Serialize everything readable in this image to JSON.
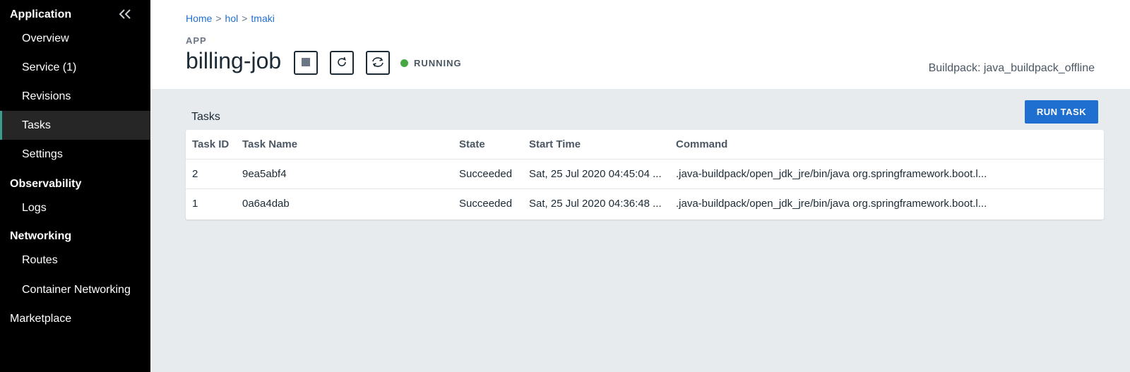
{
  "sidebar": {
    "sections": {
      "application": "Application",
      "observability": "Observability",
      "networking": "Networking",
      "marketplace": "Marketplace"
    },
    "items": [
      {
        "label": "Overview"
      },
      {
        "label": "Service (1)"
      },
      {
        "label": "Revisions"
      },
      {
        "label": "Tasks"
      },
      {
        "label": "Settings"
      },
      {
        "label": "Logs"
      },
      {
        "label": "Routes"
      },
      {
        "label": "Container Networking"
      }
    ],
    "active_item": "Tasks",
    "collapse_icon": "double-chevron-left-icon"
  },
  "breadcrumb": [
    "Home",
    "hol",
    "tmaki"
  ],
  "breadcrumb_sep": ">",
  "app": {
    "label": "APP",
    "name": "billing-job",
    "status": "RUNNING",
    "status_color": "#45a843",
    "buildpack": "Buildpack: java_buildpack_offline",
    "actions": [
      "stop-icon",
      "restart-icon",
      "restage-icon"
    ]
  },
  "tasks": {
    "title": "Tasks",
    "run_button": "RUN TASK",
    "columns": [
      "Task ID",
      "Task Name",
      "State",
      "Start Time",
      "Command"
    ],
    "rows": [
      {
        "id": "2",
        "name": "9ea5abf4",
        "state": "Succeeded",
        "start": "Sat, 25 Jul 2020 04:45:04 ...",
        "command": ".java-buildpack/open_jdk_jre/bin/java org.springframework.boot.l..."
      },
      {
        "id": "1",
        "name": "0a6a4dab",
        "state": "Succeeded",
        "start": "Sat, 25 Jul 2020 04:36:48 ...",
        "command": ".java-buildpack/open_jdk_jre/bin/java org.springframework.boot.l..."
      }
    ]
  },
  "colors": {
    "accent": "#1f6fd0",
    "sidebar_bg": "#000000",
    "active_marker": "#3b9e8a"
  }
}
